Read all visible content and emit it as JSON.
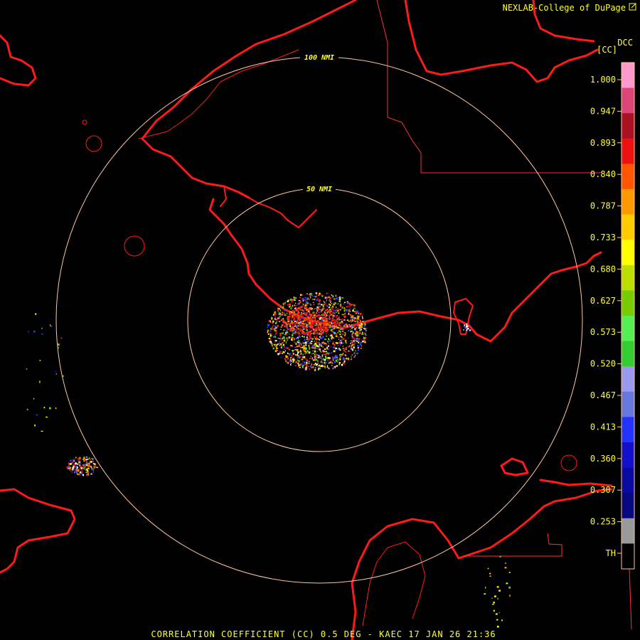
{
  "credit": {
    "text": "NEXLAB-College of DuPage",
    "icon": "external-link-icon"
  },
  "legend": {
    "product_code": "DCC",
    "unit": "[CC]",
    "ticks": [
      "1.000",
      "0.947",
      "0.893",
      "0.840",
      "0.787",
      "0.733",
      "0.680",
      "0.627",
      "0.573",
      "0.520",
      "0.467",
      "0.413",
      "0.360",
      "0.307",
      "0.253",
      "TH"
    ],
    "colors": [
      "#ff99cc",
      "#dd4477",
      "#aa1122",
      "#ee1111",
      "#ff5500",
      "#ff9900",
      "#ffcc00",
      "#ffff00",
      "#bbdd00",
      "#77cc00",
      "#55ee55",
      "#33cc33",
      "#9999ee",
      "#6677dd",
      "#2233ff",
      "#1111cc",
      "#0a0aa0",
      "#080880",
      "#999999",
      "#000000"
    ]
  },
  "rings": [
    {
      "label": "50 NMI"
    },
    {
      "label": "100 NMI"
    }
  ],
  "footer": "CORRELATION COEFFICIENT (CC) 0.5 DEG - KAEC 17 JAN 26 21:36",
  "colors": {
    "coast": "#ff1a1a",
    "ring": "#ffc8a0",
    "text": "#ffff33",
    "border": "#ff3333"
  }
}
